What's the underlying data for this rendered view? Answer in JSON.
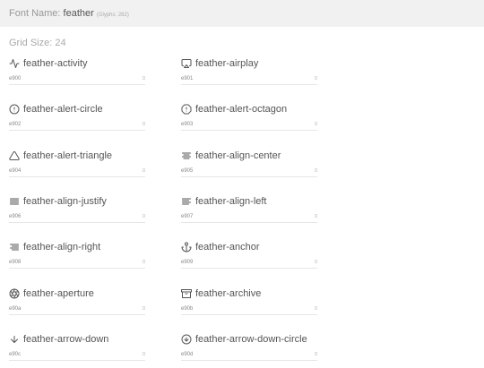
{
  "header": {
    "label": "Font Name:",
    "font_name": "feather",
    "glyph_count": "(Glyphs: 282)"
  },
  "grid_size_label": "Grid Size: 24",
  "glyphs": [
    {
      "name": "feather-activity",
      "code": "e900",
      "icon": "activity-icon"
    },
    {
      "name": "feather-airplay",
      "code": "e901",
      "icon": "airplay-icon"
    },
    {
      "name": "feather-alert-circle",
      "code": "e902",
      "icon": "alert-circle-icon"
    },
    {
      "name": "feather-alert-octagon",
      "code": "e903",
      "icon": "alert-octagon-icon"
    },
    {
      "name": "feather-alert-triangle",
      "code": "e904",
      "icon": "alert-triangle-icon"
    },
    {
      "name": "feather-align-center",
      "code": "e905",
      "icon": "align-center-icon"
    },
    {
      "name": "feather-align-justify",
      "code": "e906",
      "icon": "align-justify-icon"
    },
    {
      "name": "feather-align-left",
      "code": "e907",
      "icon": "align-left-icon"
    },
    {
      "name": "feather-align-right",
      "code": "e908",
      "icon": "align-right-icon"
    },
    {
      "name": "feather-anchor",
      "code": "e909",
      "icon": "anchor-icon"
    },
    {
      "name": "feather-aperture",
      "code": "e90a",
      "icon": "aperture-icon"
    },
    {
      "name": "feather-archive",
      "code": "e90b",
      "icon": "archive-icon"
    },
    {
      "name": "feather-arrow-down",
      "code": "e90c",
      "icon": "arrow-down-icon"
    },
    {
      "name": "feather-arrow-down-circle",
      "code": "e90d",
      "icon": "arrow-down-circle-icon"
    }
  ]
}
